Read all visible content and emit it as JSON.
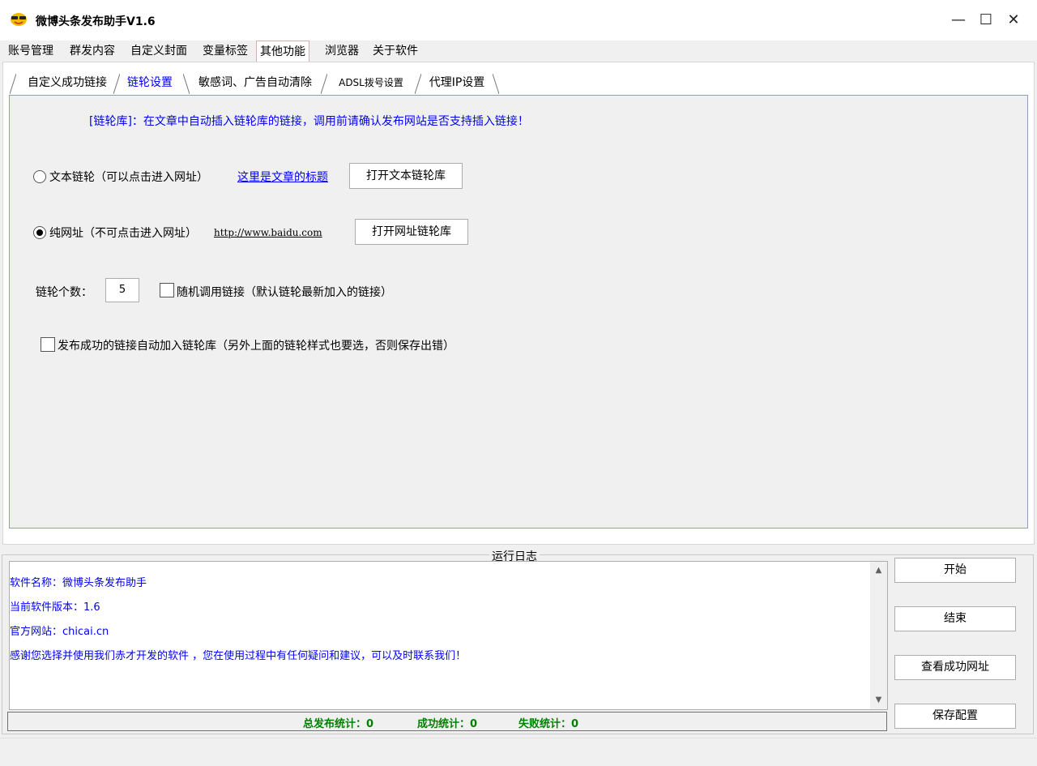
{
  "window": {
    "title": "微博头条发布助手V1.6",
    "min": "—",
    "max": "☐",
    "close": "✕"
  },
  "main_tabs": [
    "账号管理",
    "群发内容",
    "自定义封面",
    "变量标签",
    "其他功能",
    "浏览器",
    "关于软件"
  ],
  "inner_tabs": [
    "自定义成功链接",
    "链轮设置",
    "敏感词、广告自动清除",
    "ADSL拨号设置",
    "代理IP设置"
  ],
  "panel": {
    "info": "[链轮库]：在文章中自动插入链轮库的链接，调用前请确认发布网站是否支持插入链接！",
    "text_link_label": "文本链轮（可以点击进入网址）",
    "text_link_sample": "这里是文章的标题",
    "open_text_lib": "打开文本链轮库",
    "url_link_label": "纯网址（不可点击进入网址）",
    "url_link_sample": "http://www.baidu.com",
    "open_url_lib": "打开网址链轮库",
    "count_label": "链轮个数：",
    "count_value": "5",
    "random_label": "随机调用链接（默认链轮最新加入的链接）",
    "auto_add_label": "发布成功的链接自动加入链轮库（另外上面的链轮样式也要选，否则保存出错）",
    "selected_mode": "url"
  },
  "log": {
    "title": "运行日志",
    "lines": [
      "软件名称：微博头条发布助手",
      "当前软件版本：1.6",
      "官方网站：chicai.cn",
      "感谢您选择并使用我们赤才开发的软件 ，您在使用过程中有任何疑问和建议，可以及时联系我们！"
    ]
  },
  "stats": {
    "total": "总发布统计：0",
    "success": "成功统计：0",
    "fail": "失败统计：0"
  },
  "buttons": {
    "start": "开始",
    "stop": "结束",
    "view_success": "查看成功网址",
    "save_config": "保存配置"
  }
}
